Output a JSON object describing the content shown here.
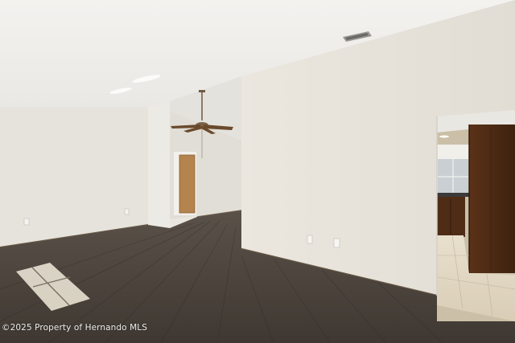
{
  "photo": {
    "watermark": "©2025 Property of Hernando MLS"
  }
}
